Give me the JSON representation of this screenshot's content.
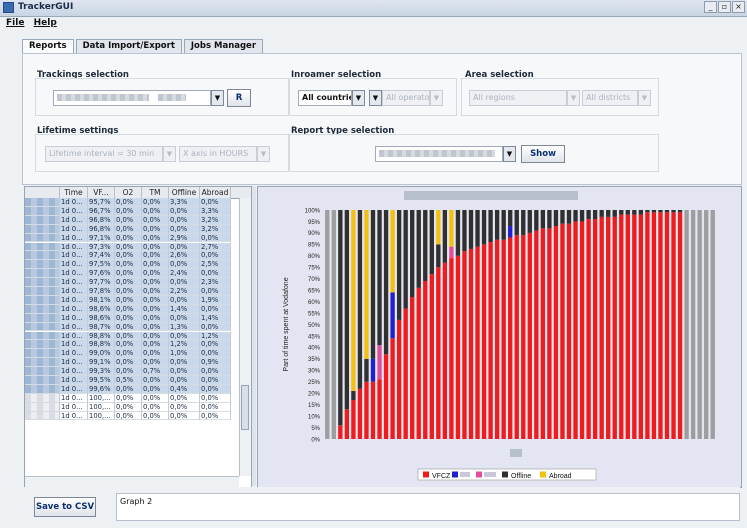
{
  "window": {
    "title": "TrackerGUI",
    "controls": [
      "_",
      "▫",
      "×"
    ]
  },
  "menu": [
    {
      "label": "File"
    },
    {
      "label": "Help"
    }
  ],
  "tabs": [
    {
      "label": "Reports",
      "active": true
    },
    {
      "label": "Data Import/Export",
      "active": false
    },
    {
      "label": "Jobs Manager",
      "active": false
    }
  ],
  "trackings": {
    "title": "Trackings selection",
    "button": "R"
  },
  "inroamer": {
    "title": "Inroamer selection",
    "country": "All countries",
    "operators": "All operators"
  },
  "area": {
    "title": "Area selection",
    "regions": "All regions",
    "districts": "All districts"
  },
  "lifetime": {
    "title": "Lifetime settings",
    "interval": "Lifetime interval = 30 min",
    "scale": "X axis in HOURS"
  },
  "report": {
    "title": "Report type selection",
    "show_button": "Show"
  },
  "table": {
    "columns": [
      "",
      "Time",
      "VF...",
      "O2",
      "TM",
      "Offline",
      "Abroad"
    ],
    "rows": [
      [
        "1d 0...",
        "95,7%",
        "0,0%",
        "0,0%",
        "3,3%",
        "0,0%"
      ],
      [
        "1d 0...",
        "96,7%",
        "0,0%",
        "0,0%",
        "0,0%",
        "3,3%"
      ],
      [
        "1d 0...",
        "96,8%",
        "0,0%",
        "0,0%",
        "0,0%",
        "3,2%"
      ],
      [
        "1d 0...",
        "96,8%",
        "0,0%",
        "0,0%",
        "0,0%",
        "3,2%"
      ],
      [
        "1d 0...",
        "97,1%",
        "0,0%",
        "0,0%",
        "2,9%",
        "0,0%"
      ],
      [
        "1d 0...",
        "97,3%",
        "0,0%",
        "0,0%",
        "0,0%",
        "2,7%"
      ],
      [
        "1d 0...",
        "97,4%",
        "0,0%",
        "0,0%",
        "2,6%",
        "0,0%"
      ],
      [
        "1d 0...",
        "97,5%",
        "0,0%",
        "0,0%",
        "0,0%",
        "2,5%"
      ],
      [
        "1d 0...",
        "97,6%",
        "0,0%",
        "0,0%",
        "2,4%",
        "0,0%"
      ],
      [
        "1d 0...",
        "97,7%",
        "0,0%",
        "0,0%",
        "0,0%",
        "2,3%"
      ],
      [
        "1d 0...",
        "97,8%",
        "0,0%",
        "0,0%",
        "2,2%",
        "0,0%"
      ],
      [
        "1d 0...",
        "98,1%",
        "0,0%",
        "0,0%",
        "0,0%",
        "1,9%"
      ],
      [
        "1d 0...",
        "98,6%",
        "0,0%",
        "0,0%",
        "1,4%",
        "0,0%"
      ],
      [
        "1d 0...",
        "98,6%",
        "0,0%",
        "0,0%",
        "0,0%",
        "1,4%"
      ],
      [
        "1d 0...",
        "98,7%",
        "0,0%",
        "0,0%",
        "1,3%",
        "0,0%"
      ],
      [
        "1d 0...",
        "98,8%",
        "0,0%",
        "0,0%",
        "0,0%",
        "1,2%"
      ],
      [
        "1d 0...",
        "98,8%",
        "0,0%",
        "0,0%",
        "1,2%",
        "0,0%"
      ],
      [
        "1d 0...",
        "99,0%",
        "0,0%",
        "0,0%",
        "1,0%",
        "0,0%"
      ],
      [
        "1d 0...",
        "99,1%",
        "0,0%",
        "0,0%",
        "0,0%",
        "0,9%"
      ],
      [
        "1d 0...",
        "99,3%",
        "0,0%",
        "0,7%",
        "0,0%",
        "0,0%"
      ],
      [
        "1d 0...",
        "99,5%",
        "0,5%",
        "0,0%",
        "0,0%",
        "0,0%"
      ],
      [
        "1d 0...",
        "99,6%",
        "0,0%",
        "0,0%",
        "0,4%",
        "0,0%"
      ],
      [
        "1d 0...",
        "100,...",
        "0,0%",
        "0,0%",
        "0,0%",
        "0,0%"
      ],
      [
        "1d 0...",
        "100,...",
        "0,0%",
        "0,0%",
        "0,0%",
        "0,0%"
      ],
      [
        "1d 0...",
        "100,...",
        "0,0%",
        "0,0%",
        "0,0%",
        "0,0%"
      ]
    ]
  },
  "bottom": {
    "save_button": "Save to CSV",
    "graph_label": "Graph 2"
  },
  "colors": {
    "vfcz": "#ee1c1c",
    "o2": "#2020d0",
    "tm": "#e0509a",
    "offline": "#303030",
    "abroad": "#f2c010",
    "na": "#9e9e9e"
  },
  "chart_data": {
    "type": "bar",
    "stacked": true,
    "title": "",
    "ylabel": "Part of time spent at Vodafone",
    "xlabel": "",
    "ylim": [
      0,
      100
    ],
    "yticks": [
      "0%",
      "5%",
      "10%",
      "15%",
      "20%",
      "25%",
      "30%",
      "35%",
      "40%",
      "45%",
      "50%",
      "55%",
      "60%",
      "65%",
      "70%",
      "75%",
      "80%",
      "85%",
      "90%",
      "95%",
      "100%"
    ],
    "legend": {
      "position": "bottom",
      "items": [
        {
          "name": "VFCZ",
          "color": "#ee1c1c"
        },
        {
          "name": "",
          "color": "#2020d0"
        },
        {
          "name": "",
          "color": "#e0509a"
        },
        {
          "name": "Offline",
          "color": "#303030"
        },
        {
          "name": "Abroad",
          "color": "#f2c010"
        }
      ]
    },
    "series": [
      {
        "name": "VFCZ",
        "values": [
          0,
          0,
          6,
          13,
          17,
          22,
          25,
          25,
          26,
          37,
          44,
          52,
          57,
          62,
          66,
          69,
          72,
          75,
          77,
          79,
          80,
          82,
          83,
          84,
          85,
          86,
          87,
          87,
          88,
          89,
          89,
          90,
          91,
          92,
          92,
          93,
          94,
          94,
          95,
          95,
          96,
          96,
          97,
          97,
          97,
          98,
          98,
          98,
          98,
          99,
          99,
          99,
          99,
          99,
          99,
          0,
          0,
          0,
          0,
          0
        ]
      },
      {
        "name": "O2",
        "values": [
          0,
          0,
          0,
          0,
          0,
          0,
          0,
          10,
          0,
          0,
          20,
          0,
          0,
          0,
          0,
          0,
          0,
          0,
          0,
          0,
          0,
          0,
          0,
          0,
          0,
          0,
          0,
          0,
          5,
          0,
          0,
          0,
          0,
          0,
          0,
          0,
          0,
          0,
          0,
          0,
          0,
          0,
          0,
          0,
          0,
          0,
          0,
          0,
          0,
          0,
          0,
          0,
          0,
          0,
          0,
          0,
          0,
          0,
          0,
          0
        ]
      },
      {
        "name": "TM",
        "values": [
          0,
          0,
          0,
          0,
          0,
          0,
          0,
          0,
          15,
          0,
          0,
          0,
          0,
          0,
          0,
          0,
          0,
          0,
          0,
          5,
          0,
          0,
          0,
          0,
          0,
          0,
          0,
          0,
          0,
          0,
          0,
          0,
          0,
          0,
          0,
          0,
          0,
          0,
          0,
          0,
          0,
          0,
          0,
          0,
          0,
          0,
          0,
          0,
          0,
          0,
          0,
          0,
          0,
          0,
          0,
          0,
          0,
          0,
          0,
          0
        ]
      },
      {
        "name": "Offline",
        "values": [
          0,
          0,
          94,
          87,
          4,
          78,
          10,
          65,
          59,
          63,
          0,
          48,
          43,
          38,
          34,
          31,
          28,
          10,
          23,
          0,
          20,
          18,
          17,
          16,
          15,
          14,
          13,
          13,
          7,
          11,
          11,
          10,
          9,
          8,
          8,
          7,
          6,
          6,
          5,
          5,
          4,
          4,
          3,
          3,
          3,
          2,
          2,
          2,
          2,
          1,
          1,
          1,
          1,
          1,
          1,
          0,
          0,
          0,
          0,
          0
        ]
      },
      {
        "name": "Abroad",
        "values": [
          0,
          0,
          0,
          0,
          79,
          0,
          65,
          0,
          0,
          0,
          36,
          0,
          0,
          0,
          0,
          0,
          0,
          15,
          0,
          16,
          0,
          0,
          0,
          0,
          0,
          0,
          0,
          0,
          0,
          0,
          0,
          0,
          0,
          0,
          0,
          0,
          0,
          0,
          0,
          0,
          0,
          0,
          0,
          0,
          0,
          0,
          0,
          0,
          0,
          0,
          0,
          0,
          0,
          0,
          0,
          0,
          0,
          0,
          0,
          0
        ]
      },
      {
        "name": "N/A",
        "values": [
          100,
          100,
          0,
          0,
          0,
          0,
          0,
          0,
          0,
          0,
          0,
          0,
          0,
          0,
          0,
          0,
          0,
          0,
          0,
          0,
          0,
          0,
          0,
          0,
          0,
          0,
          0,
          0,
          0,
          0,
          0,
          0,
          0,
          0,
          0,
          0,
          0,
          0,
          0,
          0,
          0,
          0,
          0,
          0,
          0,
          0,
          0,
          0,
          0,
          0,
          0,
          0,
          0,
          0,
          0,
          100,
          100,
          100,
          100,
          100
        ]
      }
    ]
  }
}
